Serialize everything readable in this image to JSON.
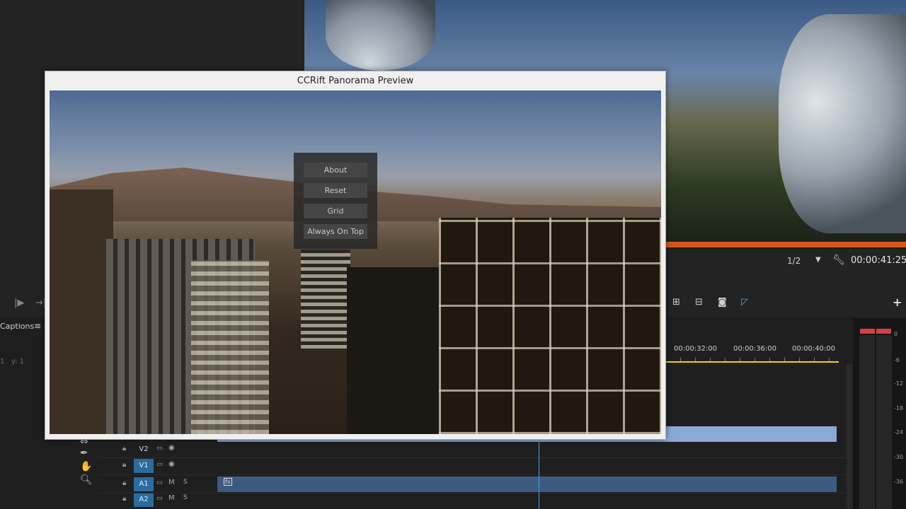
{
  "left_panel": {
    "captions_tab": "Captions",
    "menu_icon": "menu-icon",
    "coord_x": "1",
    "coord_y": "y: 1"
  },
  "program_monitor": {
    "resolution": "1/2",
    "timecode": "00:00:41:25"
  },
  "timeline": {
    "ruler": [
      "00:00:32:00",
      "00:00:36:00",
      "00:00:40:00"
    ],
    "tracks": [
      {
        "name": "V2",
        "on": false
      },
      {
        "name": "V1",
        "on": true
      },
      {
        "name": "A1",
        "on": true,
        "m": "M",
        "s": "S"
      },
      {
        "name": "A2",
        "on": true,
        "m": "M",
        "s": "S"
      }
    ],
    "audio_clip_badge": "fx"
  },
  "audio_meter": {
    "db_labels": [
      "0",
      "-6",
      "-12",
      "-18",
      "-24",
      "-30",
      "-36"
    ]
  },
  "dialog": {
    "title": "CCRift Panorama Preview",
    "menu": {
      "about": "About",
      "reset": "Reset",
      "grid": "Grid",
      "always_on_top": "Always On Top"
    }
  },
  "colors": {
    "track_active": "#2b6ba0",
    "playhead": "#4aa2e8",
    "playback_bar": "#f0d020",
    "meter_peak": "#d84040"
  }
}
